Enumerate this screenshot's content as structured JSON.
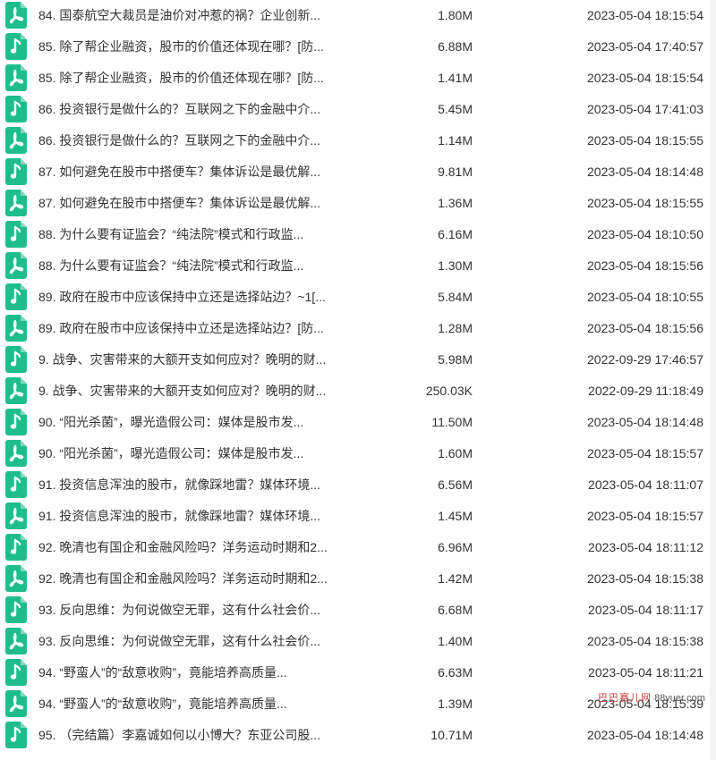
{
  "colors": {
    "icon_green": "#1fbd8c",
    "text": "#333333",
    "background": "#ffffff",
    "watermark_red": "#d23a3a"
  },
  "files": [
    {
      "name": "84. 国泰航空大裁员是油价对冲惹的祸？企业创新...",
      "size": "1.80M",
      "date": "2023-05-04 18:15:54",
      "icon": "pdf-icon"
    },
    {
      "name": "85. 除了帮企业融资，股市的价值还体现在哪？[防...",
      "size": "6.88M",
      "date": "2023-05-04 17:40:57",
      "icon": "audio-icon"
    },
    {
      "name": "85. 除了帮企业融资，股市的价值还体现在哪？[防...",
      "size": "1.41M",
      "date": "2023-05-04 18:15:54",
      "icon": "pdf-icon"
    },
    {
      "name": "86. 投资银行是做什么的？互联网之下的金融中介...",
      "size": "5.45M",
      "date": "2023-05-04 17:41:03",
      "icon": "audio-icon"
    },
    {
      "name": "86. 投资银行是做什么的？互联网之下的金融中介...",
      "size": "1.14M",
      "date": "2023-05-04 18:15:55",
      "icon": "pdf-icon"
    },
    {
      "name": "87. 如何避免在股市中搭便车？集体诉讼是最优解...",
      "size": "9.81M",
      "date": "2023-05-04 18:14:48",
      "icon": "audio-icon"
    },
    {
      "name": "87. 如何避免在股市中搭便车？集体诉讼是最优解...",
      "size": "1.36M",
      "date": "2023-05-04 18:15:55",
      "icon": "pdf-icon"
    },
    {
      "name": "88. 为什么要有证监会？“纯法院”模式和行政监...",
      "size": "6.16M",
      "date": "2023-05-04 18:10:50",
      "icon": "audio-icon"
    },
    {
      "name": "88. 为什么要有证监会？“纯法院”模式和行政监...",
      "size": "1.30M",
      "date": "2023-05-04 18:15:56",
      "icon": "pdf-icon"
    },
    {
      "name": "89. 政府在股市中应该保持中立还是选择站边？~1[...",
      "size": "5.84M",
      "date": "2023-05-04 18:10:55",
      "icon": "audio-icon"
    },
    {
      "name": "89. 政府在股市中应该保持中立还是选择站边？[防...",
      "size": "1.28M",
      "date": "2023-05-04 18:15:56",
      "icon": "pdf-icon"
    },
    {
      "name": "9. 战争、灾害带来的大额开支如何应对？晚明的财...",
      "size": "5.98M",
      "date": "2022-09-29 17:46:57",
      "icon": "audio-icon"
    },
    {
      "name": "9. 战争、灾害带来的大额开支如何应对？晚明的财...",
      "size": "250.03K",
      "date": "2022-09-29 11:18:49",
      "icon": "pdf-icon"
    },
    {
      "name": "90. “阳光杀菌”，曝光造假公司：媒体是股市发...",
      "size": "11.50M",
      "date": "2023-05-04 18:14:48",
      "icon": "audio-icon"
    },
    {
      "name": "90. “阳光杀菌”，曝光造假公司：媒体是股市发...",
      "size": "1.60M",
      "date": "2023-05-04 18:15:57",
      "icon": "pdf-icon"
    },
    {
      "name": "91. 投资信息浑浊的股市，就像踩地雷？媒体环境...",
      "size": "6.56M",
      "date": "2023-05-04 18:11:07",
      "icon": "audio-icon"
    },
    {
      "name": "91. 投资信息浑浊的股市，就像踩地雷？媒体环境...",
      "size": "1.45M",
      "date": "2023-05-04 18:15:57",
      "icon": "pdf-icon"
    },
    {
      "name": "92. 晚清也有国企和金融风险吗？洋务运动时期和2...",
      "size": "6.96M",
      "date": "2023-05-04 18:11:12",
      "icon": "audio-icon"
    },
    {
      "name": "92. 晚清也有国企和金融风险吗？洋务运动时期和2...",
      "size": "1.42M",
      "date": "2023-05-04 18:15:38",
      "icon": "pdf-icon"
    },
    {
      "name": "93. 反向思维：为何说做空无罪，这有什么社会价...",
      "size": "6.68M",
      "date": "2023-05-04 18:11:17",
      "icon": "audio-icon"
    },
    {
      "name": "93. 反向思维：为何说做空无罪，这有什么社会价...",
      "size": "1.40M",
      "date": "2023-05-04 18:15:38",
      "icon": "pdf-icon"
    },
    {
      "name": "94. “野蛮人”的“敌意收购”，竟能培养高质量...",
      "size": "6.63M",
      "date": "2023-05-04 18:11:21",
      "icon": "audio-icon"
    },
    {
      "name": "94. “野蛮人”的“敌意收购”，竟能培养高质量...",
      "size": "1.39M",
      "date": "2023-05-04 18:15:39",
      "icon": "pdf-icon"
    },
    {
      "name": "95. （完结篇）李嘉诚如何以小博大？东亚公司股...",
      "size": "10.71M",
      "date": "2023-05-04 18:14:48",
      "icon": "audio-icon"
    }
  ],
  "watermark": {
    "site_name": "巴巴赛儿网",
    "url": "88yuer.com"
  }
}
